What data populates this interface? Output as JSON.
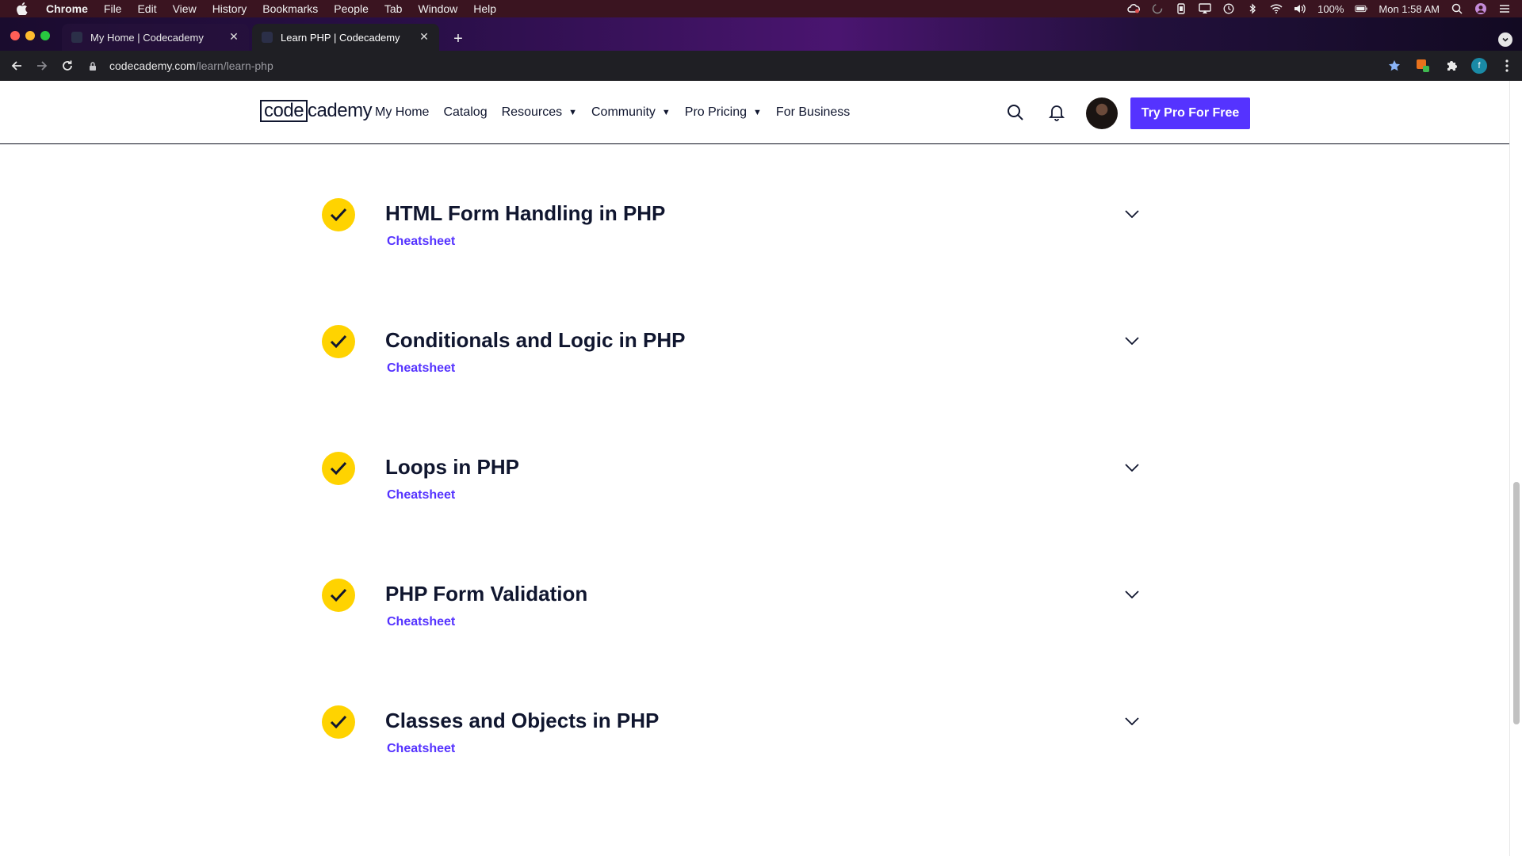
{
  "os_menubar": {
    "app_name": "Chrome",
    "items": [
      "File",
      "Edit",
      "View",
      "History",
      "Bookmarks",
      "People",
      "Tab",
      "Window",
      "Help"
    ],
    "battery": "100%",
    "clock": "Mon 1:58 AM"
  },
  "browser": {
    "tabs": [
      {
        "title": "My Home | Codecademy",
        "active": false
      },
      {
        "title": "Learn PHP | Codecademy",
        "active": true
      }
    ],
    "url_host": "codecademy.com",
    "url_path": "/learn/learn-php",
    "profile_initial": "f"
  },
  "site": {
    "logo_boxed": "code",
    "logo_rest": "cademy",
    "nav": {
      "my_home": "My Home",
      "catalog": "Catalog",
      "resources": "Resources",
      "community": "Community",
      "pro_pricing": "Pro Pricing",
      "for_business": "For Business"
    },
    "cta_label": "Try Pro For Free"
  },
  "modules": [
    {
      "title": "HTML Form Handling in PHP",
      "link": "Cheatsheet",
      "completed": true
    },
    {
      "title": "Conditionals and Logic in PHP",
      "link": "Cheatsheet",
      "completed": true
    },
    {
      "title": "Loops in PHP",
      "link": "Cheatsheet",
      "completed": true
    },
    {
      "title": "PHP Form Validation",
      "link": "Cheatsheet",
      "completed": true
    },
    {
      "title": "Classes and Objects in PHP",
      "link": "Cheatsheet",
      "completed": true
    }
  ],
  "colors": {
    "brand_purple": "#5533ff",
    "check_yellow": "#ffd300",
    "navy_text": "#10162f"
  }
}
